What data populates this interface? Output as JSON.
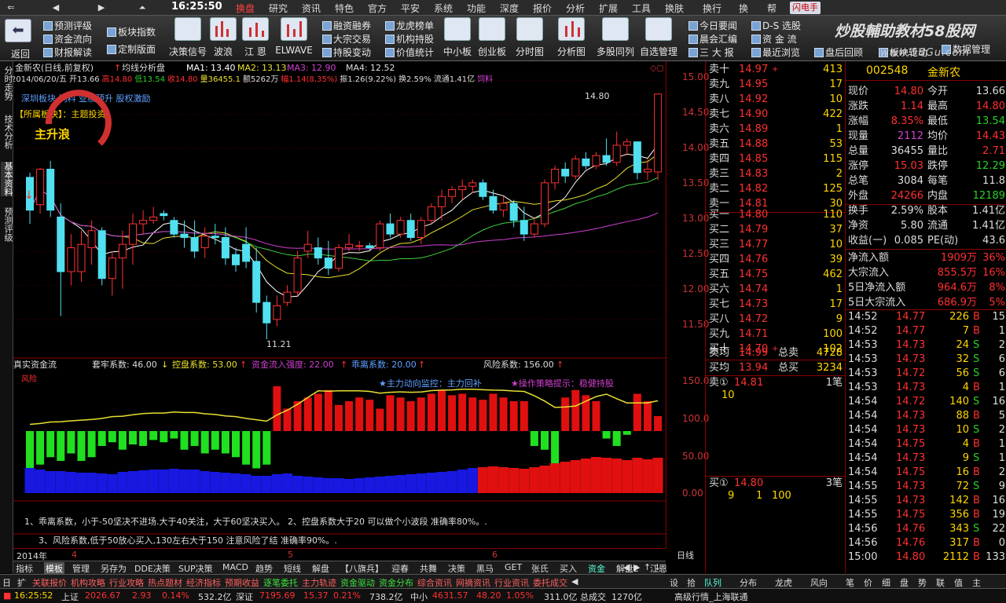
{
  "menubar": {
    "nav_buttons": [
      "⇐",
      "◀",
      "▶",
      "⏶"
    ],
    "clock": "16:25:50",
    "items": [
      "换盘",
      "研究",
      "资讯",
      "特色",
      "官方",
      "平安",
      "系统",
      "功能",
      "深度",
      "报价",
      "分析",
      "扩展",
      "工具",
      "换肤",
      "换行",
      "换",
      "帮"
    ],
    "active": "换盘",
    "fast_btn": "闪电手",
    "watermark": "炒股輔助教材58股网",
    "watermark_url": "www.58Gu.com"
  },
  "toolbar": {
    "back": "返回",
    "small": [
      {
        "label": "预测评级"
      },
      {
        "label": "资金流向"
      },
      {
        "label": "财报解读"
      },
      {
        "label": "板块指数"
      },
      {
        "label": "定制版面"
      },
      {
        "label": "融资融券"
      },
      {
        "label": "大宗交易"
      },
      {
        "label": "持股变动"
      },
      {
        "label": "龙虎榜单"
      },
      {
        "label": "机构持股"
      },
      {
        "label": "价值统计"
      },
      {
        "label": "今日要闻"
      },
      {
        "label": "晨会汇编"
      },
      {
        "label": "三 大 报"
      },
      {
        "label": "D-S 选股"
      },
      {
        "label": "资 金 流"
      },
      {
        "label": "最近浏览"
      },
      {
        "label": "盘后回顾"
      },
      {
        "label": "板块轮动"
      },
      {
        "label": "数据管理"
      }
    ],
    "big": [
      "决策信号",
      "波浪",
      "江 恩",
      "ELWAVE",
      "中小板",
      "创业板",
      "分时图",
      "分析图",
      "多股同列",
      "自选管理"
    ]
  },
  "left_tabs": [
    "分时走势",
    "技术分析",
    "基本资料",
    "预测评级"
  ],
  "chart": {
    "header": {
      "stock": "金新农(日线,前复权)",
      "indicator": "均线分析盘",
      "ma1_label": "MA1:",
      "ma1": "13.40",
      "ma2_label": "MA2:",
      "ma2": "13.13",
      "ma3_label": "MA3:",
      "ma3": "12.90",
      "ma4_label": "MA4:",
      "ma4": "12.52"
    },
    "info": {
      "date": "2014/06/20/五",
      "open_l": "开",
      "open": "13.66",
      "high_l": "高",
      "high": "14.80",
      "low_l": "低",
      "low": "13.54",
      "close_l": "收",
      "close": "14.80",
      "vol_l": "量",
      "vol": "36455.1",
      "amt_l": "额",
      "amt": "5262万",
      "chg_l": "幅",
      "chg": "1.14(8.35%)",
      "amp_l": "振",
      "amp": "1.26(9.22%)",
      "turn_l": "换",
      "turn": "2.59%",
      "float_l": "流通",
      "float": "1.41亿",
      "tag": "饲料"
    },
    "board_line": "深圳板块 饲料 业绩预升 股权激励",
    "sector_line": "【所属板块】：主题投资",
    "badge": "主升浪",
    "annot_high": "14.80",
    "annot_low": "11.21",
    "lower_header": {
      "title": "真实资金流",
      "a": "套牢系数: 46.00",
      "b": "控盘系数: 53.00",
      "c": "资金流入强度: 22.00",
      "d": "乖离系数: 20.00",
      "e": "风险系数: 156.00"
    },
    "lower_tags": {
      "left": "风险",
      "mid": "★主力动向监控：主力回补",
      "right": "★操作策略提示：稳健持股"
    },
    "notes": [
      "1、乖离系数，小于-50坚决不进场.大于40关注，大于60坚决买入。     2、控盘系数大于20 可以做个小波段 准确率80%。.",
      "3、风险系数,低于50放心买入,130左右大于150 注意风险了结 准确率90%。."
    ],
    "date_axis": {
      "year": "2014年",
      "m4": "4",
      "m5": "5",
      "m6": "6",
      "period": "日线"
    },
    "price_axis": [
      "15.00",
      "14.50",
      "14.00",
      "13.50",
      "13.00",
      "12.50",
      "12.00",
      "11.50"
    ],
    "lower_axis": [
      "150.0",
      "100.0",
      "50.00",
      "0.00"
    ],
    "chart_data": {
      "type": "candlestick",
      "title": "金新农(日线,前复权)",
      "ylim": [
        11.2,
        15.05
      ],
      "candles": [
        [
          13.58,
          13.65,
          12.9,
          13.1
        ],
        [
          13.18,
          13.72,
          13.05,
          13.7
        ],
        [
          13.7,
          13.82,
          13.0,
          13.1
        ],
        [
          13.0,
          13.2,
          11.55,
          12.2
        ],
        [
          12.2,
          12.75,
          12.0,
          12.55
        ],
        [
          12.2,
          12.8,
          12.05,
          12.6
        ],
        [
          12.55,
          12.95,
          12.3,
          12.8
        ],
        [
          12.8,
          12.85,
          12.0,
          12.1
        ],
        [
          12.1,
          12.5,
          11.85,
          12.4
        ],
        [
          12.4,
          12.8,
          11.95,
          12.6
        ],
        [
          12.6,
          13.05,
          12.3,
          12.9
        ],
        [
          12.9,
          13.1,
          12.75,
          12.95
        ],
        [
          12.95,
          13.15,
          12.9,
          13.0
        ],
        [
          13.05,
          13.1,
          12.95,
          13.02
        ],
        [
          12.95,
          13.0,
          12.7,
          12.75
        ],
        [
          12.75,
          12.95,
          12.55,
          12.7
        ],
        [
          12.7,
          12.95,
          12.4,
          12.5
        ],
        [
          12.55,
          12.85,
          12.4,
          12.72
        ],
        [
          12.72,
          12.9,
          12.6,
          12.7
        ],
        [
          12.7,
          12.85,
          12.3,
          12.4
        ],
        [
          12.45,
          12.55,
          12.2,
          12.3
        ],
        [
          12.6,
          12.85,
          12.25,
          12.35
        ],
        [
          12.35,
          12.55,
          11.6,
          11.75
        ],
        [
          11.75,
          11.85,
          11.21,
          11.45
        ],
        [
          11.5,
          11.85,
          11.4,
          11.7
        ],
        [
          11.75,
          12.0,
          11.7,
          11.9
        ],
        [
          11.9,
          12.5,
          11.85,
          12.4
        ],
        [
          12.5,
          12.8,
          12.4,
          12.6
        ],
        [
          12.55,
          12.7,
          12.3,
          12.4
        ],
        [
          12.4,
          12.65,
          12.15,
          12.25
        ],
        [
          12.25,
          12.6,
          12.2,
          12.55
        ],
        [
          12.55,
          12.75,
          12.5,
          12.6
        ],
        [
          12.58,
          12.65,
          12.5,
          12.58
        ],
        [
          12.58,
          12.62,
          12.52,
          12.55
        ],
        [
          12.55,
          12.95,
          12.5,
          12.9
        ],
        [
          12.9,
          13.05,
          12.7,
          12.75
        ],
        [
          12.75,
          13.0,
          12.7,
          12.95
        ],
        [
          12.95,
          13.05,
          12.65,
          12.7
        ],
        [
          12.7,
          13.0,
          12.6,
          12.95
        ],
        [
          12.95,
          13.2,
          12.9,
          13.15
        ],
        [
          13.15,
          13.4,
          12.95,
          13.3
        ],
        [
          13.3,
          13.45,
          13.2,
          13.4
        ],
        [
          13.4,
          13.55,
          13.25,
          13.45
        ],
        [
          13.45,
          13.55,
          13.35,
          13.5
        ],
        [
          13.5,
          13.55,
          13.25,
          13.3
        ],
        [
          13.3,
          13.4,
          13.05,
          13.1
        ],
        [
          13.1,
          13.3,
          13.0,
          13.2
        ],
        [
          13.2,
          13.25,
          12.85,
          12.95
        ],
        [
          12.95,
          13.15,
          12.65,
          12.75
        ],
        [
          12.75,
          13.0,
          12.7,
          12.9
        ],
        [
          12.9,
          13.55,
          12.85,
          13.5
        ],
        [
          13.5,
          13.75,
          13.4,
          13.7
        ],
        [
          13.7,
          13.8,
          13.5,
          13.6
        ],
        [
          13.6,
          13.9,
          13.55,
          13.85
        ],
        [
          13.85,
          13.95,
          13.7,
          13.75
        ],
        [
          13.75,
          13.95,
          13.7,
          13.9
        ],
        [
          13.9,
          14.15,
          13.75,
          13.8
        ],
        [
          13.8,
          14.25,
          13.75,
          14.05
        ],
        [
          14.05,
          14.15,
          13.9,
          14.1
        ],
        [
          14.1,
          14.05,
          13.55,
          13.65
        ],
        [
          13.66,
          13.85,
          13.54,
          13.7
        ],
        [
          13.66,
          14.8,
          13.54,
          14.8
        ]
      ],
      "ma_legend": [
        "MA1",
        "MA2",
        "MA3",
        "MA4"
      ],
      "lower_values": [
        -50,
        -45,
        -35,
        -40,
        -30,
        -40,
        -35,
        -20,
        -15,
        -25,
        -18,
        -20,
        -12,
        -15,
        -10,
        -25,
        -20,
        -30,
        -25,
        -30,
        -35,
        -45,
        -50,
        -45,
        60,
        30,
        40,
        45,
        50,
        55,
        35,
        40,
        45,
        42,
        30,
        48,
        45,
        40,
        45,
        50,
        55,
        48,
        50,
        45,
        42,
        50,
        45,
        40,
        40,
        -20,
        -25,
        -45,
        45,
        55,
        48,
        40,
        -10,
        -20,
        -5,
        50,
        40,
        20
      ],
      "base_values": [
        32,
        30,
        28,
        28,
        27,
        26,
        26,
        25,
        24,
        27,
        28,
        29,
        30,
        30,
        31,
        30,
        30,
        28,
        27,
        26,
        25,
        24,
        22,
        22,
        24,
        25,
        22,
        21,
        20,
        19,
        19,
        18,
        19,
        20,
        21,
        22,
        23,
        24,
        25,
        26,
        27,
        28,
        30,
        32,
        33,
        34,
        33,
        32,
        31,
        33,
        35,
        38,
        40,
        42,
        44,
        46,
        45,
        44,
        42,
        45,
        43,
        45
      ]
    }
  },
  "orderbook": {
    "sell": [
      {
        "label": "卖十",
        "price": "14.97",
        "vol": "413",
        "mark": "+"
      },
      {
        "label": "卖九",
        "price": "14.95",
        "vol": "17",
        "mark": ""
      },
      {
        "label": "卖八",
        "price": "14.92",
        "vol": "10",
        "mark": ""
      },
      {
        "label": "卖七",
        "price": "14.90",
        "vol": "422",
        "mark": ""
      },
      {
        "label": "卖六",
        "price": "14.89",
        "vol": "1",
        "mark": ""
      },
      {
        "label": "卖五",
        "price": "14.88",
        "vol": "53",
        "mark": ""
      },
      {
        "label": "卖四",
        "price": "14.85",
        "vol": "115",
        "mark": ""
      },
      {
        "label": "卖三",
        "price": "14.83",
        "vol": "2",
        "mark": ""
      },
      {
        "label": "卖二",
        "price": "14.82",
        "vol": "125",
        "mark": ""
      },
      {
        "label": "卖一",
        "price": "14.81",
        "vol": "30",
        "mark": ""
      }
    ],
    "buy": [
      {
        "label": "买一",
        "price": "14.80",
        "vol": "110",
        "mark": ""
      },
      {
        "label": "买二",
        "price": "14.79",
        "vol": "37",
        "mark": ""
      },
      {
        "label": "买三",
        "price": "14.77",
        "vol": "10",
        "mark": ""
      },
      {
        "label": "买四",
        "price": "14.76",
        "vol": "39",
        "mark": ""
      },
      {
        "label": "买五",
        "price": "14.75",
        "vol": "462",
        "mark": ""
      },
      {
        "label": "买六",
        "price": "14.74",
        "vol": "1",
        "mark": ""
      },
      {
        "label": "买七",
        "price": "14.73",
        "vol": "17",
        "mark": ""
      },
      {
        "label": "买八",
        "price": "14.72",
        "vol": "9",
        "mark": ""
      },
      {
        "label": "买九",
        "price": "14.71",
        "vol": "100",
        "mark": ""
      },
      {
        "label": "买十",
        "price": "14.70",
        "vol": "102",
        "mark": "+"
      }
    ],
    "avg_sell_label": "卖均",
    "avg_sell": "14.99",
    "total_sell_label": "总卖",
    "total_sell": "4728",
    "avg_buy_label": "买均",
    "avg_buy": "13.94",
    "total_buy_label": "总买",
    "total_buy": "3234",
    "queue_sell": {
      "label": "卖①",
      "price": "14.81",
      "count": "1笔",
      "qty": "10"
    },
    "queue_buy": {
      "label": "买①",
      "price": "14.80",
      "count": "3笔",
      "qty1": "9",
      "qty2": "1",
      "qty3": "100"
    }
  },
  "quote": {
    "code": "002548",
    "name": "金新农",
    "rows": [
      {
        "l1": "现价",
        "v1": "14.80",
        "l2": "今开",
        "v2": "13.66",
        "c1": "#ff3030",
        "c2": "#ddd"
      },
      {
        "l1": "涨跌",
        "v1": "1.14",
        "l2": "最高",
        "v2": "14.80",
        "c1": "#ff3030",
        "c2": "#ff3030"
      },
      {
        "l1": "涨幅",
        "v1": "8.35%",
        "l2": "最低",
        "v2": "13.54",
        "c1": "#ff3030",
        "c2": "#28d028"
      },
      {
        "l1": "现量",
        "v1": "2112",
        "l2": "均价",
        "v2": "14.43",
        "c1": "#d040d0",
        "c2": "#ff3030"
      },
      {
        "l1": "总量",
        "v1": "36455",
        "l2": "量比",
        "v2": "2.71",
        "c1": "#ddd",
        "c2": "#ff3030"
      },
      {
        "l1": "涨停",
        "v1": "15.03",
        "l2": "跌停",
        "v2": "12.29",
        "c1": "#ff3030",
        "c2": "#28d028"
      },
      {
        "l1": "总笔",
        "v1": "3084",
        "l2": "每笔",
        "v2": "11.8",
        "c1": "#ddd",
        "c2": "#ddd"
      },
      {
        "l1": "外盘",
        "v1": "24266",
        "l2": "内盘",
        "v2": "12189",
        "c1": "#ff3030",
        "c2": "#28d028"
      },
      {
        "l1": "换手",
        "v1": "2.59%",
        "l2": "股本",
        "v2": "1.41亿",
        "c1": "#ddd",
        "c2": "#ddd"
      },
      {
        "l1": "净资",
        "v1": "5.80",
        "l2": "流通",
        "v2": "1.41亿",
        "c1": "#ddd",
        "c2": "#ddd"
      },
      {
        "l1": "收益(一)",
        "v1": "0.085",
        "l2": "PE(动)",
        "v2": "43.6",
        "c1": "#ddd",
        "c2": "#ddd"
      }
    ],
    "flows": [
      {
        "label": "净流入额",
        "val": "1909万",
        "pct": "36%"
      },
      {
        "label": "大宗流入",
        "val": "855.5万",
        "pct": "16%"
      },
      {
        "label": "5日净流入额",
        "val": "964.6万",
        "pct": "8%"
      },
      {
        "label": "5日大宗流入",
        "val": "686.9万",
        "pct": "5%"
      }
    ],
    "ticks": [
      {
        "t": "14:52",
        "p": "14.77",
        "v": "226",
        "s": "B",
        "n": "15"
      },
      {
        "t": "14:52",
        "p": "14.77",
        "v": "7",
        "s": "B",
        "n": "1"
      },
      {
        "t": "14:53",
        "p": "14.73",
        "v": "24",
        "s": "S",
        "n": "2"
      },
      {
        "t": "14:53",
        "p": "14.73",
        "v": "32",
        "s": "S",
        "n": "6"
      },
      {
        "t": "14:53",
        "p": "14.72",
        "v": "56",
        "s": "S",
        "n": "6"
      },
      {
        "t": "14:53",
        "p": "14.73",
        "v": "4",
        "s": "B",
        "n": "1"
      },
      {
        "t": "14:54",
        "p": "14.72",
        "v": "140",
        "s": "S",
        "n": "16"
      },
      {
        "t": "14:54",
        "p": "14.73",
        "v": "88",
        "s": "B",
        "n": "5"
      },
      {
        "t": "14:54",
        "p": "14.73",
        "v": "10",
        "s": "S",
        "n": "2"
      },
      {
        "t": "14:54",
        "p": "14.75",
        "v": "4",
        "s": "B",
        "n": "1"
      },
      {
        "t": "14:54",
        "p": "14.73",
        "v": "9",
        "s": "S",
        "n": "1"
      },
      {
        "t": "14:54",
        "p": "14.75",
        "v": "16",
        "s": "B",
        "n": "2"
      },
      {
        "t": "14:55",
        "p": "14.73",
        "v": "72",
        "s": "S",
        "n": "9"
      },
      {
        "t": "14:55",
        "p": "14.73",
        "v": "142",
        "s": "B",
        "n": "16"
      },
      {
        "t": "14:55",
        "p": "14.75",
        "v": "356",
        "s": "B",
        "n": "19"
      },
      {
        "t": "14:56",
        "p": "14.76",
        "v": "343",
        "s": "S",
        "n": "22"
      },
      {
        "t": "14:56",
        "p": "14.76",
        "v": "317",
        "s": "B",
        "n": "0"
      },
      {
        "t": "15:00",
        "p": "14.80",
        "v": "2112",
        "s": "B",
        "n": "133"
      }
    ]
  },
  "bottom_tabs": [
    "指标",
    "模板",
    "管理",
    "另存为",
    "DDE决策",
    "SUP决策",
    "MACD",
    "趋势",
    "短线",
    "解盘",
    "【八旗兵】",
    "迎春",
    "共舞",
    "决策",
    "黑马",
    "GET",
    "张氏",
    "买入",
    "资金",
    "解盘2",
    "江恩"
  ],
  "bottom_tabs_active": "模板",
  "bottom_tabs_scroll": [
    "◀",
    "▶",
    "↑",
    "↓"
  ],
  "bottom_row2": [
    "日",
    "扩",
    "关联报价",
    "机构攻略",
    "行业攻略",
    "热点题材",
    "经济指标",
    "预期收益",
    "逐笔委托",
    "主力轨迹",
    "资金驱动",
    "资金分布",
    "综合资讯",
    "网摘资讯",
    "行业资讯",
    "委托成交",
    "◀",
    "设",
    "拾",
    "队列",
    "分布",
    "龙虎",
    "风向",
    "笔",
    "价",
    "细",
    "盘",
    "势",
    "联",
    "值",
    "主"
  ],
  "statusbar": {
    "time": "16:25:52",
    "sh_l": "上证",
    "sh": "2026.67",
    "sh_chg": "2.93",
    "sh_pct": "0.14%",
    "sh_amt": "532.2亿",
    "sz_l": "深证",
    "sz": "7195.69",
    "sz_chg": "15.37",
    "sz_pct": "0.21%",
    "sz_amt": "738.2亿",
    "zx_l": "中小",
    "zx": "4631.57",
    "zx_chg": "48.20",
    "zx_pct": "1.05%",
    "zx_amt": "311.0亿",
    "total_l": "总成交",
    "total": "1270亿",
    "market": "高级行情_上海联通"
  }
}
